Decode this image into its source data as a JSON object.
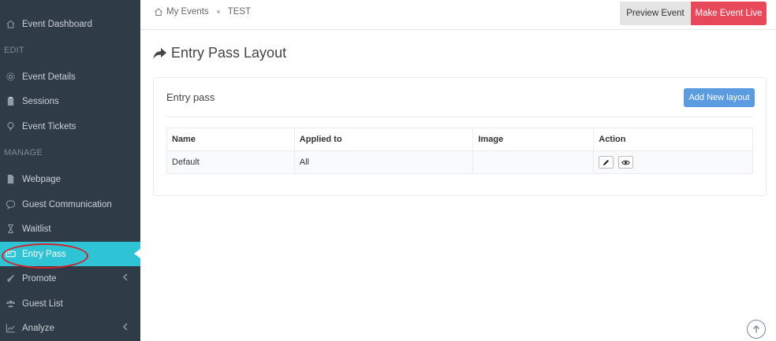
{
  "sidebar": {
    "items": [
      {
        "label": "Event Dashboard",
        "icon": "home-icon"
      },
      {
        "label": "Event Details",
        "icon": "gear-icon"
      },
      {
        "label": "Sessions",
        "icon": "clipboard-icon"
      },
      {
        "label": "Event Tickets",
        "icon": "lightbulb-icon"
      },
      {
        "label": "Webpage",
        "icon": "file-icon"
      },
      {
        "label": "Guest Communication",
        "icon": "chat-icon"
      },
      {
        "label": "Waitlist",
        "icon": "hourglass-icon"
      },
      {
        "label": "Entry Pass",
        "icon": "ticket-icon"
      },
      {
        "label": "Promote",
        "icon": "rocket-icon"
      },
      {
        "label": "Guest List",
        "icon": "users-icon"
      },
      {
        "label": "Analyze",
        "icon": "chart-icon"
      }
    ],
    "sections": {
      "edit": "EDIT",
      "manage": "MANAGE"
    },
    "active_color": "#2ec4d6",
    "bg_color": "#2f3b46"
  },
  "breadcrumb": {
    "home": "My Events",
    "current": "TEST"
  },
  "header": {
    "preview": "Preview Event",
    "live": "Make Event Live",
    "live_color": "#e8495a"
  },
  "page": {
    "title": "Entry Pass Layout"
  },
  "panel": {
    "title": "Entry pass",
    "add_button": "Add New layout",
    "columns": [
      "Name",
      "Applied to",
      "Image",
      "Action"
    ],
    "rows": [
      {
        "name": "Default",
        "applied_to": "All",
        "image": ""
      }
    ]
  }
}
